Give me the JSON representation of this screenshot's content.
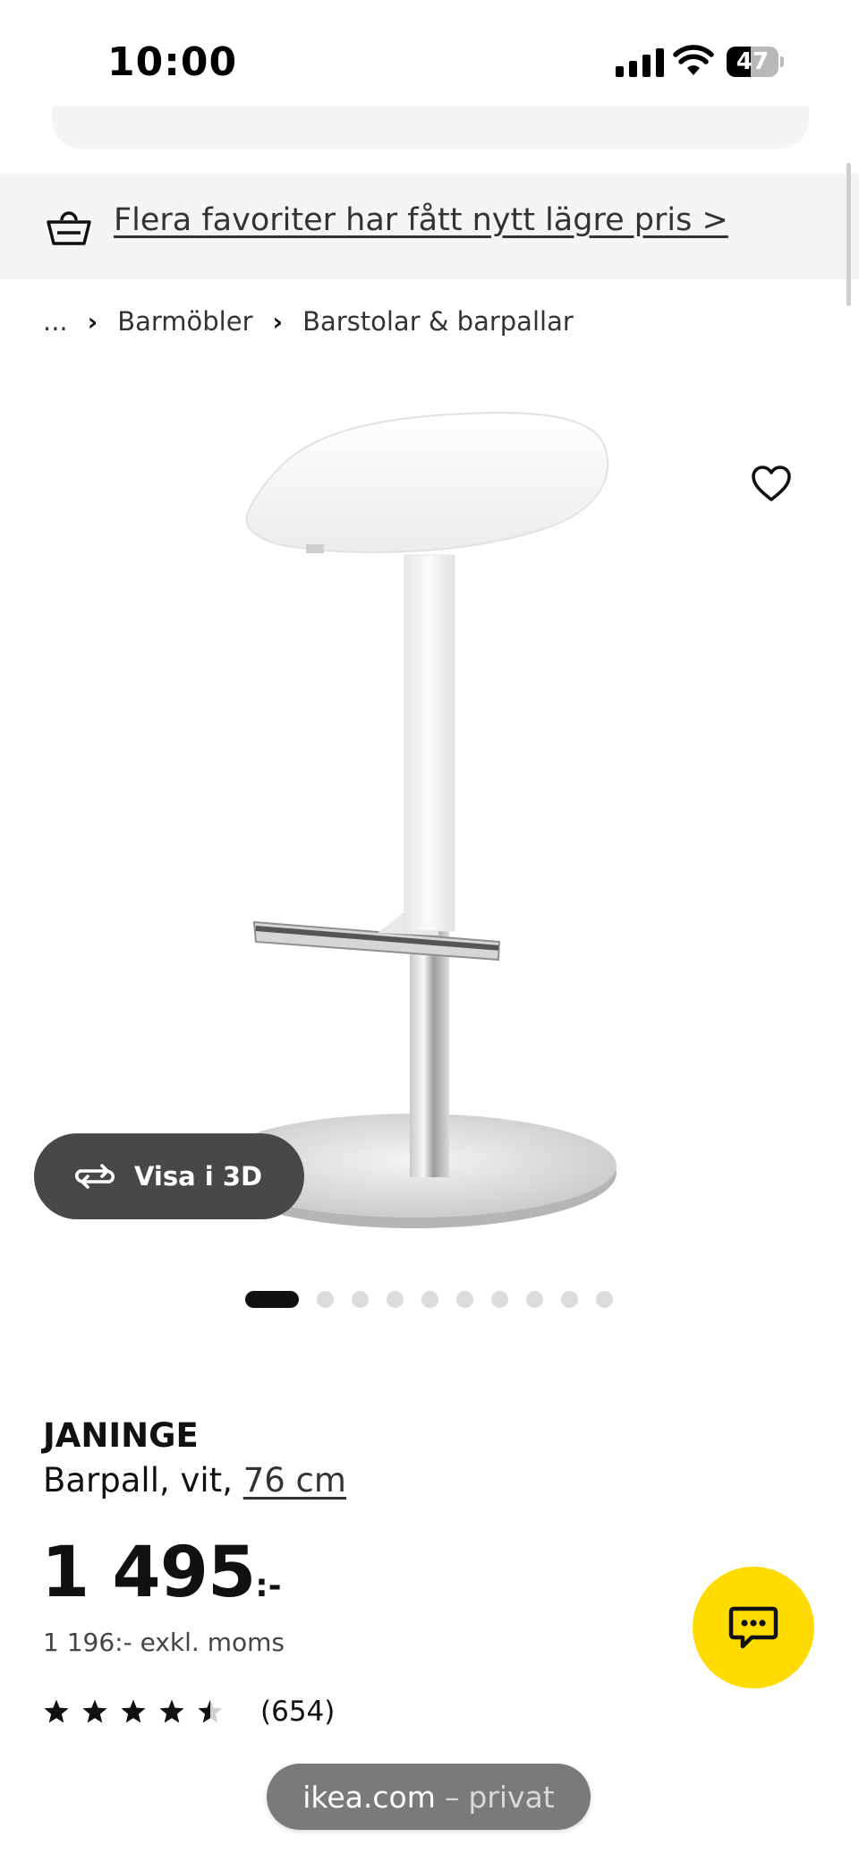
{
  "status_bar": {
    "time": "10:00",
    "battery": "47",
    "battery_level": 0.47
  },
  "promo": {
    "text": "Flera favoriter har fått nytt lägre pris >"
  },
  "breadcrumb": {
    "items": [
      "...",
      "Barmöbler",
      "Barstolar & barpallar"
    ]
  },
  "gallery": {
    "view_3d_label": "Visa i 3D",
    "image_count": 10,
    "active_index": 0
  },
  "product": {
    "name": "JANINGE",
    "description": "Barpall, vit, ",
    "size": "76 cm",
    "price": "1 495",
    "price_suffix": ":-",
    "price_ex_vat": "1 196:- exkl. moms",
    "rating": 4.5,
    "review_count": "(654)"
  },
  "browser": {
    "host": "ikea.com",
    "separator": "–",
    "mode": "privat"
  },
  "colors": {
    "chat_button": "#ffdb00",
    "promo_bg": "#f5f5f5",
    "view3d_bg": "#484848"
  }
}
